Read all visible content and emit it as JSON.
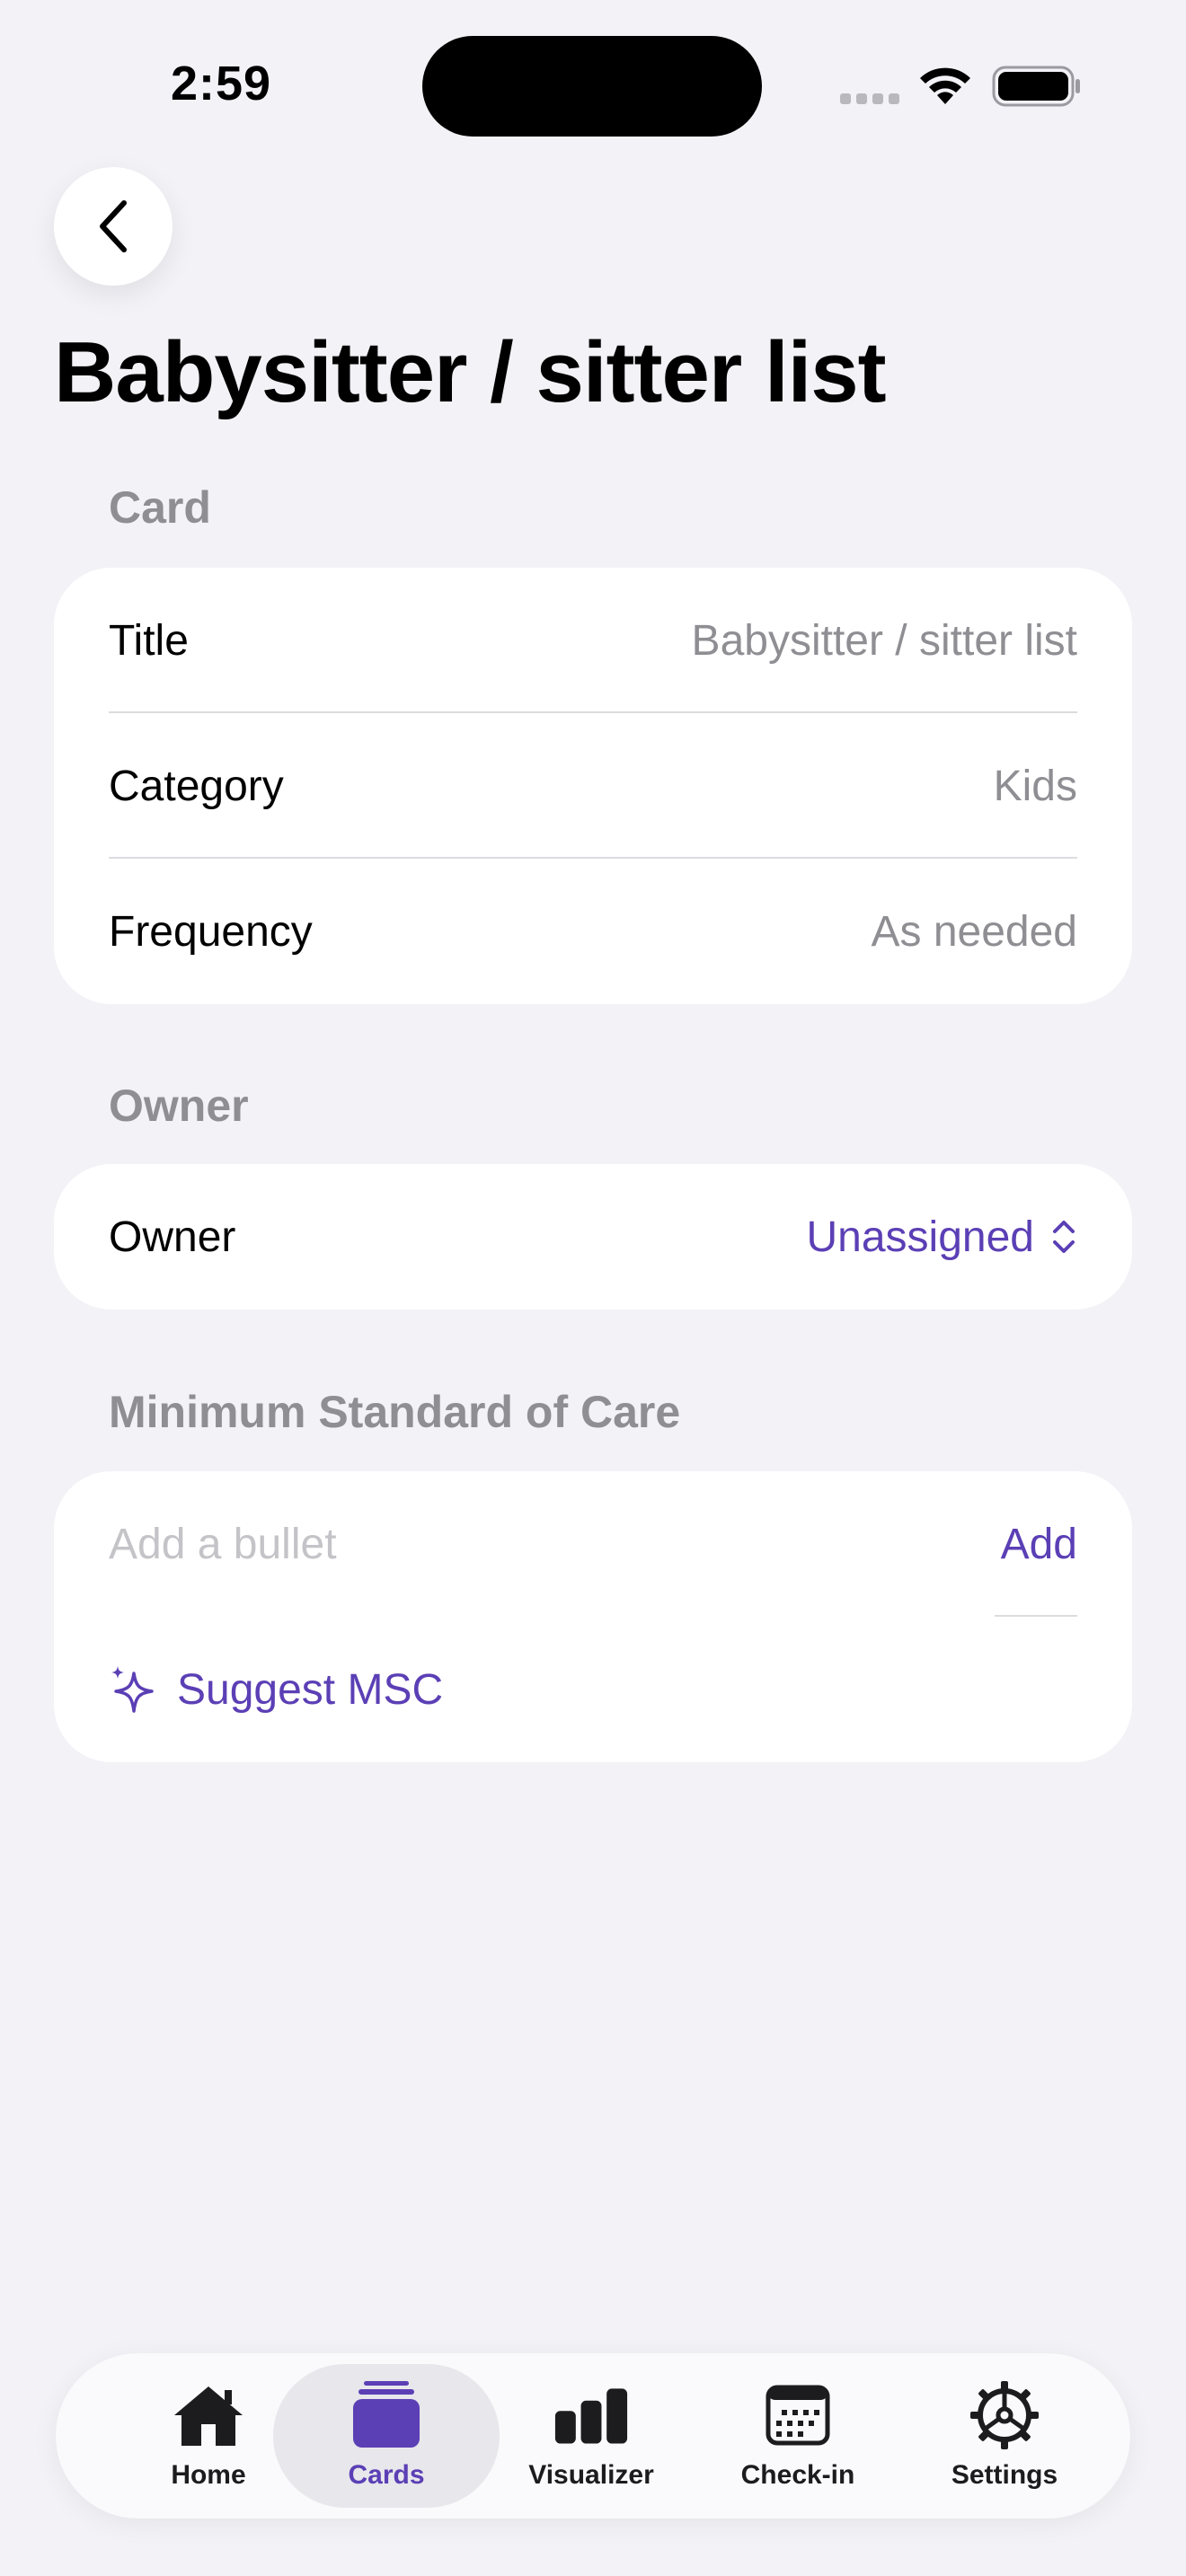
{
  "status_bar": {
    "time": "2:59"
  },
  "page": {
    "title": "Babysitter / sitter list"
  },
  "sections": {
    "card": {
      "header": "Card",
      "rows": [
        {
          "label": "Title",
          "value": "Babysitter / sitter list"
        },
        {
          "label": "Category",
          "value": "Kids"
        },
        {
          "label": "Frequency",
          "value": "As needed"
        }
      ]
    },
    "owner": {
      "header": "Owner",
      "label": "Owner",
      "value": "Unassigned"
    },
    "msc": {
      "header": "Minimum Standard of Care",
      "input_placeholder": "Add a bullet",
      "input_value": "",
      "add_label": "Add",
      "suggest_label": "Suggest MSC"
    }
  },
  "tab_bar": {
    "active": "cards",
    "tabs": [
      {
        "id": "home",
        "label": "Home",
        "icon": "house-icon"
      },
      {
        "id": "cards",
        "label": "Cards",
        "icon": "stacked-cards-icon"
      },
      {
        "id": "visualizer",
        "label": "Visualizer",
        "icon": "bar-chart-icon"
      },
      {
        "id": "checkin",
        "label": "Check-in",
        "icon": "calendar-icon"
      },
      {
        "id": "settings",
        "label": "Settings",
        "icon": "gear-icon"
      }
    ]
  },
  "colors": {
    "accent": "#5b3fb5",
    "background": "#f2f2f7",
    "secondary_text": "#8e8e93",
    "card_bg": "#ffffff"
  }
}
